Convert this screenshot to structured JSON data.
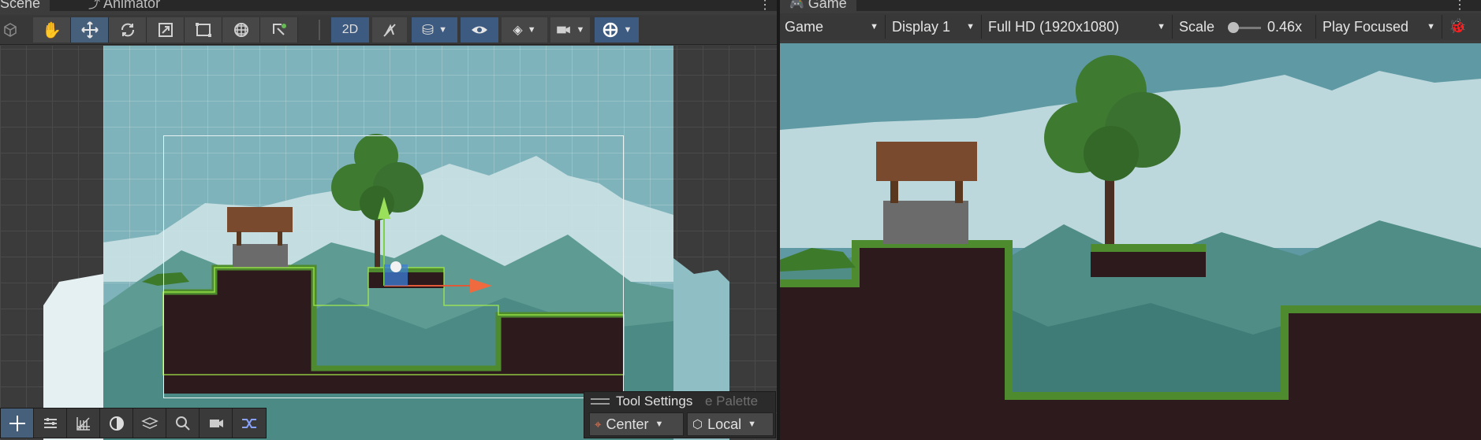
{
  "scene": {
    "tab_label": "Scene",
    "animator_tab_label": "Animator",
    "toolbar": {
      "view_2d_label": "2D",
      "tools": [
        "hand-tool",
        "move-tool",
        "rotate-tool",
        "scale-tool",
        "rect-tool",
        "transform-tool",
        "custom-tool"
      ]
    },
    "tool_settings": {
      "title": "Tool Settings",
      "hidden_title": "e Palette",
      "pivot_label": "Center",
      "space_label": "Local"
    }
  },
  "game": {
    "tab_label": "Game",
    "mode_label": "Game",
    "display_label": "Display 1",
    "resolution_label": "Full HD (1920x1080)",
    "scale_label": "Scale",
    "scale_value": "0.46x",
    "play_mode_label": "Play Focused"
  },
  "colors": {
    "selected_tool": "#46607c",
    "sky": "#7fb3bb",
    "ground": "#2d1a1c",
    "grass": "#4e8a2e"
  }
}
